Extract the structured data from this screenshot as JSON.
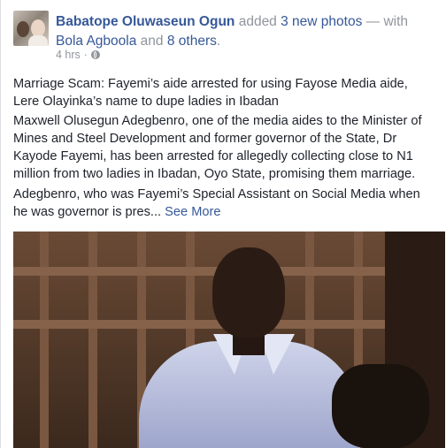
{
  "post": {
    "author_name": "Babatope Oluwaseun Ogun",
    "action_text": "added",
    "photos_link": "3 new photos",
    "with_text": "— with",
    "tagged_name": "Bola Agboola",
    "and_text": "and",
    "others_link": "8 others",
    "period": ".",
    "time": "4 hrs",
    "separator": "·",
    "privacy_icon": "globe-icon",
    "paragraph1": "Marriage Scam: Fayemi’s aide arrested for using Fayose Media aide, Lere Olayinka’s name to dupe ladies in Ibadan",
    "paragraph2": "Maxwell Olusegun Adegbenro, one of the media aides to the Minister of Mines and Steel Development and former governor of the State, Dr Kayode Fayemi, has been arrested for allegedly collecting close to N1 million from two ladies in Ibadan, Oyo State, promising them marriage.",
    "paragraph3": "Adegbenro, who was Fayemi’s Special Assistant on Social Media when he was governor is pres...",
    "see_more": "See More"
  },
  "colors": {
    "link": "#365899",
    "muted": "#90949c",
    "text": "#1d2129"
  }
}
